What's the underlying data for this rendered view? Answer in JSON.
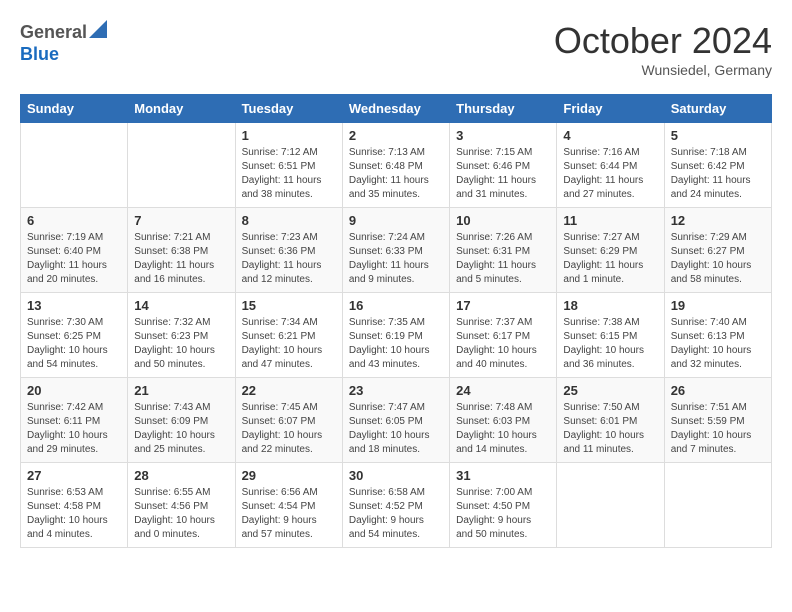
{
  "header": {
    "logo_general": "General",
    "logo_blue": "Blue",
    "month": "October 2024",
    "location": "Wunsiedel, Germany"
  },
  "weekdays": [
    "Sunday",
    "Monday",
    "Tuesday",
    "Wednesday",
    "Thursday",
    "Friday",
    "Saturday"
  ],
  "weeks": [
    [
      {
        "day": "",
        "info": ""
      },
      {
        "day": "",
        "info": ""
      },
      {
        "day": "1",
        "info": "Sunrise: 7:12 AM\nSunset: 6:51 PM\nDaylight: 11 hours and 38 minutes."
      },
      {
        "day": "2",
        "info": "Sunrise: 7:13 AM\nSunset: 6:48 PM\nDaylight: 11 hours and 35 minutes."
      },
      {
        "day": "3",
        "info": "Sunrise: 7:15 AM\nSunset: 6:46 PM\nDaylight: 11 hours and 31 minutes."
      },
      {
        "day": "4",
        "info": "Sunrise: 7:16 AM\nSunset: 6:44 PM\nDaylight: 11 hours and 27 minutes."
      },
      {
        "day": "5",
        "info": "Sunrise: 7:18 AM\nSunset: 6:42 PM\nDaylight: 11 hours and 24 minutes."
      }
    ],
    [
      {
        "day": "6",
        "info": "Sunrise: 7:19 AM\nSunset: 6:40 PM\nDaylight: 11 hours and 20 minutes."
      },
      {
        "day": "7",
        "info": "Sunrise: 7:21 AM\nSunset: 6:38 PM\nDaylight: 11 hours and 16 minutes."
      },
      {
        "day": "8",
        "info": "Sunrise: 7:23 AM\nSunset: 6:36 PM\nDaylight: 11 hours and 12 minutes."
      },
      {
        "day": "9",
        "info": "Sunrise: 7:24 AM\nSunset: 6:33 PM\nDaylight: 11 hours and 9 minutes."
      },
      {
        "day": "10",
        "info": "Sunrise: 7:26 AM\nSunset: 6:31 PM\nDaylight: 11 hours and 5 minutes."
      },
      {
        "day": "11",
        "info": "Sunrise: 7:27 AM\nSunset: 6:29 PM\nDaylight: 11 hours and 1 minute."
      },
      {
        "day": "12",
        "info": "Sunrise: 7:29 AM\nSunset: 6:27 PM\nDaylight: 10 hours and 58 minutes."
      }
    ],
    [
      {
        "day": "13",
        "info": "Sunrise: 7:30 AM\nSunset: 6:25 PM\nDaylight: 10 hours and 54 minutes."
      },
      {
        "day": "14",
        "info": "Sunrise: 7:32 AM\nSunset: 6:23 PM\nDaylight: 10 hours and 50 minutes."
      },
      {
        "day": "15",
        "info": "Sunrise: 7:34 AM\nSunset: 6:21 PM\nDaylight: 10 hours and 47 minutes."
      },
      {
        "day": "16",
        "info": "Sunrise: 7:35 AM\nSunset: 6:19 PM\nDaylight: 10 hours and 43 minutes."
      },
      {
        "day": "17",
        "info": "Sunrise: 7:37 AM\nSunset: 6:17 PM\nDaylight: 10 hours and 40 minutes."
      },
      {
        "day": "18",
        "info": "Sunrise: 7:38 AM\nSunset: 6:15 PM\nDaylight: 10 hours and 36 minutes."
      },
      {
        "day": "19",
        "info": "Sunrise: 7:40 AM\nSunset: 6:13 PM\nDaylight: 10 hours and 32 minutes."
      }
    ],
    [
      {
        "day": "20",
        "info": "Sunrise: 7:42 AM\nSunset: 6:11 PM\nDaylight: 10 hours and 29 minutes."
      },
      {
        "day": "21",
        "info": "Sunrise: 7:43 AM\nSunset: 6:09 PM\nDaylight: 10 hours and 25 minutes."
      },
      {
        "day": "22",
        "info": "Sunrise: 7:45 AM\nSunset: 6:07 PM\nDaylight: 10 hours and 22 minutes."
      },
      {
        "day": "23",
        "info": "Sunrise: 7:47 AM\nSunset: 6:05 PM\nDaylight: 10 hours and 18 minutes."
      },
      {
        "day": "24",
        "info": "Sunrise: 7:48 AM\nSunset: 6:03 PM\nDaylight: 10 hours and 14 minutes."
      },
      {
        "day": "25",
        "info": "Sunrise: 7:50 AM\nSunset: 6:01 PM\nDaylight: 10 hours and 11 minutes."
      },
      {
        "day": "26",
        "info": "Sunrise: 7:51 AM\nSunset: 5:59 PM\nDaylight: 10 hours and 7 minutes."
      }
    ],
    [
      {
        "day": "27",
        "info": "Sunrise: 6:53 AM\nSunset: 4:58 PM\nDaylight: 10 hours and 4 minutes."
      },
      {
        "day": "28",
        "info": "Sunrise: 6:55 AM\nSunset: 4:56 PM\nDaylight: 10 hours and 0 minutes."
      },
      {
        "day": "29",
        "info": "Sunrise: 6:56 AM\nSunset: 4:54 PM\nDaylight: 9 hours and 57 minutes."
      },
      {
        "day": "30",
        "info": "Sunrise: 6:58 AM\nSunset: 4:52 PM\nDaylight: 9 hours and 54 minutes."
      },
      {
        "day": "31",
        "info": "Sunrise: 7:00 AM\nSunset: 4:50 PM\nDaylight: 9 hours and 50 minutes."
      },
      {
        "day": "",
        "info": ""
      },
      {
        "day": "",
        "info": ""
      }
    ]
  ]
}
